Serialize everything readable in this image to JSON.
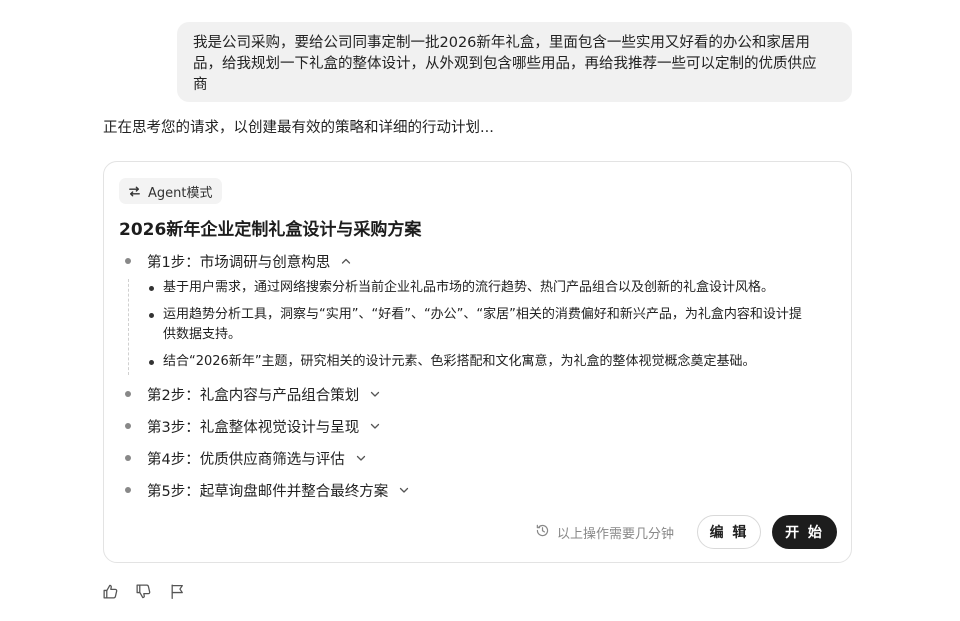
{
  "user_message": "我是公司采购，要给公司同事定制一批2026新年礼盒，里面包含一些实用又好看的办公和家居用品，给我规划一下礼盒的整体设计，从外观到包含哪些用品，再给我推荐一些可以定制的优质供应商",
  "user_lines": [
    "我是公司采购，要给公司同事定制一批2026新年礼盒，里面包含一些实用又好看的办公和家居用",
    "品，给我规划一下礼盒的整体设计，从外观到包含哪些用品，再给我推荐一些可以定制的优质供应",
    "商"
  ],
  "thinking_text": "正在思考您的请求，以创建最有效的策略和详细的行动计划...",
  "plan": {
    "mode_label": "Agent模式",
    "title": "2026新年企业定制礼盒设计与采购方案",
    "steps": [
      {
        "label": "第1步：市场调研与创意构思",
        "expanded": true,
        "details": [
          "基于用户需求，通过网络搜索分析当前企业礼品市场的流行趋势、热门产品组合以及创新的礼盒设计风格。",
          "运用趋势分析工具，洞察与“实用”、“好看”、“办公”、“家居”相关的消费偏好和新兴产品，为礼盒内容和设计提供数据支持。",
          "结合“2026新年”主题，研究相关的设计元素、色彩搭配和文化寓意，为礼盒的整体视觉概念奠定基础。"
        ]
      },
      {
        "label": "第2步：礼盒内容与产品组合策划",
        "expanded": false
      },
      {
        "label": "第3步：礼盒整体视觉设计与呈现",
        "expanded": false
      },
      {
        "label": "第4步：优质供应商筛选与评估",
        "expanded": false
      },
      {
        "label": "第5步：起草询盘邮件并整合最终方案",
        "expanded": false
      }
    ],
    "time_hint": "以上操作需要几分钟",
    "edit_label": "编 辑",
    "start_label": "开 始"
  },
  "feedback_icons": [
    "thumbs-up-icon",
    "thumbs-down-icon",
    "flag-icon"
  ],
  "colors": {
    "bubble": "#f1f1f1",
    "primary_button": "#1d1d1d",
    "muted_text": "#888888"
  }
}
